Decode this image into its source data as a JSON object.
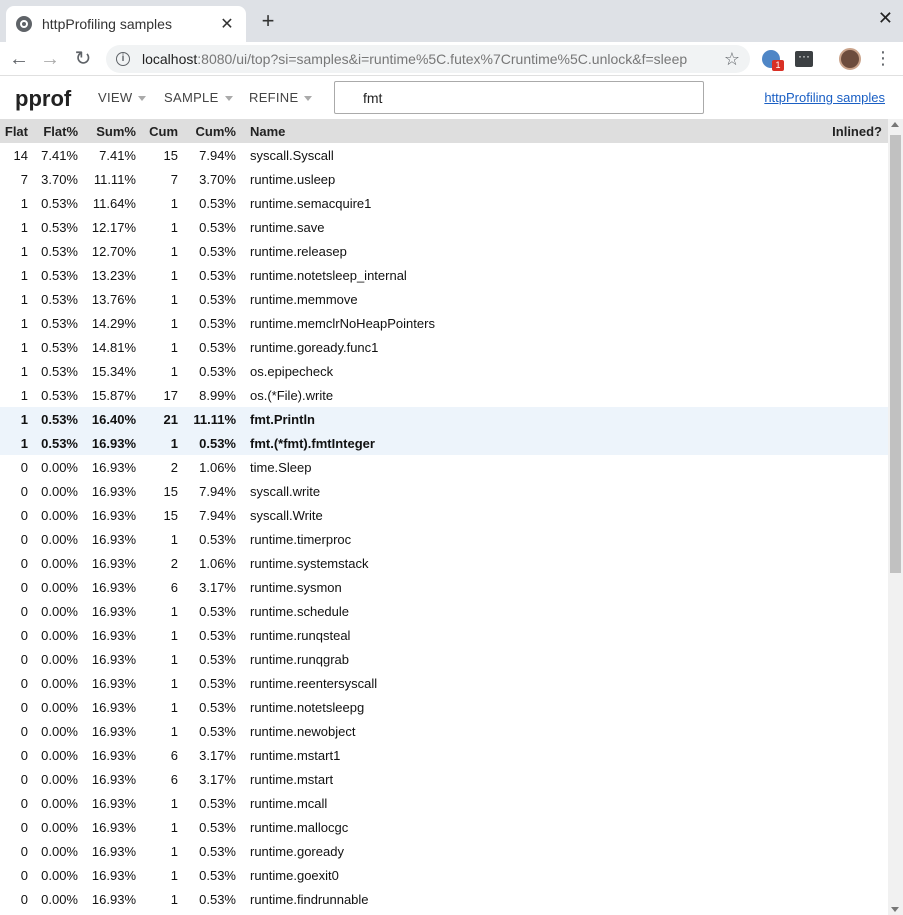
{
  "browser": {
    "tab_title": "httpProfiling samples",
    "tab_close": "✕",
    "new_tab": "+",
    "window_close": "✕",
    "url_host": "localhost",
    "url_rest": ":8080/ui/top?si=samples&i=runtime%5C.futex%7Cruntime%5C.unlock&f=sleep",
    "extension_badge": "1"
  },
  "header": {
    "logo": "pprof",
    "menus": [
      "VIEW",
      "SAMPLE",
      "REFINE"
    ],
    "search_value": "fmt",
    "link": "httpProfiling samples"
  },
  "table": {
    "columns": [
      "Flat",
      "Flat%",
      "Sum%",
      "Cum",
      "Cum%",
      "Name",
      "Inlined?"
    ],
    "rows": [
      [
        "14",
        "7.41%",
        "7.41%",
        "15",
        "7.94%",
        "syscall.Syscall",
        ""
      ],
      [
        "7",
        "3.70%",
        "11.11%",
        "7",
        "3.70%",
        "runtime.usleep",
        ""
      ],
      [
        "1",
        "0.53%",
        "11.64%",
        "1",
        "0.53%",
        "runtime.semacquire1",
        ""
      ],
      [
        "1",
        "0.53%",
        "12.17%",
        "1",
        "0.53%",
        "runtime.save",
        ""
      ],
      [
        "1",
        "0.53%",
        "12.70%",
        "1",
        "0.53%",
        "runtime.releasep",
        ""
      ],
      [
        "1",
        "0.53%",
        "13.23%",
        "1",
        "0.53%",
        "runtime.notetsleep_internal",
        ""
      ],
      [
        "1",
        "0.53%",
        "13.76%",
        "1",
        "0.53%",
        "runtime.memmove",
        ""
      ],
      [
        "1",
        "0.53%",
        "14.29%",
        "1",
        "0.53%",
        "runtime.memclrNoHeapPointers",
        ""
      ],
      [
        "1",
        "0.53%",
        "14.81%",
        "1",
        "0.53%",
        "runtime.goready.func1",
        ""
      ],
      [
        "1",
        "0.53%",
        "15.34%",
        "1",
        "0.53%",
        "os.epipecheck",
        ""
      ],
      [
        "1",
        "0.53%",
        "15.87%",
        "17",
        "8.99%",
        "os.(*File).write",
        ""
      ],
      [
        "1",
        "0.53%",
        "16.40%",
        "21",
        "11.11%",
        "fmt.Println",
        ""
      ],
      [
        "1",
        "0.53%",
        "16.93%",
        "1",
        "0.53%",
        "fmt.(*fmt).fmtInteger",
        ""
      ],
      [
        "0",
        "0.00%",
        "16.93%",
        "2",
        "1.06%",
        "time.Sleep",
        ""
      ],
      [
        "0",
        "0.00%",
        "16.93%",
        "15",
        "7.94%",
        "syscall.write",
        ""
      ],
      [
        "0",
        "0.00%",
        "16.93%",
        "15",
        "7.94%",
        "syscall.Write",
        ""
      ],
      [
        "0",
        "0.00%",
        "16.93%",
        "1",
        "0.53%",
        "runtime.timerproc",
        ""
      ],
      [
        "0",
        "0.00%",
        "16.93%",
        "2",
        "1.06%",
        "runtime.systemstack",
        ""
      ],
      [
        "0",
        "0.00%",
        "16.93%",
        "6",
        "3.17%",
        "runtime.sysmon",
        ""
      ],
      [
        "0",
        "0.00%",
        "16.93%",
        "1",
        "0.53%",
        "runtime.schedule",
        ""
      ],
      [
        "0",
        "0.00%",
        "16.93%",
        "1",
        "0.53%",
        "runtime.runqsteal",
        ""
      ],
      [
        "0",
        "0.00%",
        "16.93%",
        "1",
        "0.53%",
        "runtime.runqgrab",
        ""
      ],
      [
        "0",
        "0.00%",
        "16.93%",
        "1",
        "0.53%",
        "runtime.reentersyscall",
        ""
      ],
      [
        "0",
        "0.00%",
        "16.93%",
        "1",
        "0.53%",
        "runtime.notetsleepg",
        ""
      ],
      [
        "0",
        "0.00%",
        "16.93%",
        "1",
        "0.53%",
        "runtime.newobject",
        ""
      ],
      [
        "0",
        "0.00%",
        "16.93%",
        "6",
        "3.17%",
        "runtime.mstart1",
        ""
      ],
      [
        "0",
        "0.00%",
        "16.93%",
        "6",
        "3.17%",
        "runtime.mstart",
        ""
      ],
      [
        "0",
        "0.00%",
        "16.93%",
        "1",
        "0.53%",
        "runtime.mcall",
        ""
      ],
      [
        "0",
        "0.00%",
        "16.93%",
        "1",
        "0.53%",
        "runtime.mallocgc",
        ""
      ],
      [
        "0",
        "0.00%",
        "16.93%",
        "1",
        "0.53%",
        "runtime.goready",
        ""
      ],
      [
        "0",
        "0.00%",
        "16.93%",
        "1",
        "0.53%",
        "runtime.goexit0",
        ""
      ],
      [
        "0",
        "0.00%",
        "16.93%",
        "1",
        "0.53%",
        "runtime.findrunnable",
        ""
      ]
    ],
    "highlighted_rows": [
      11,
      12
    ]
  }
}
